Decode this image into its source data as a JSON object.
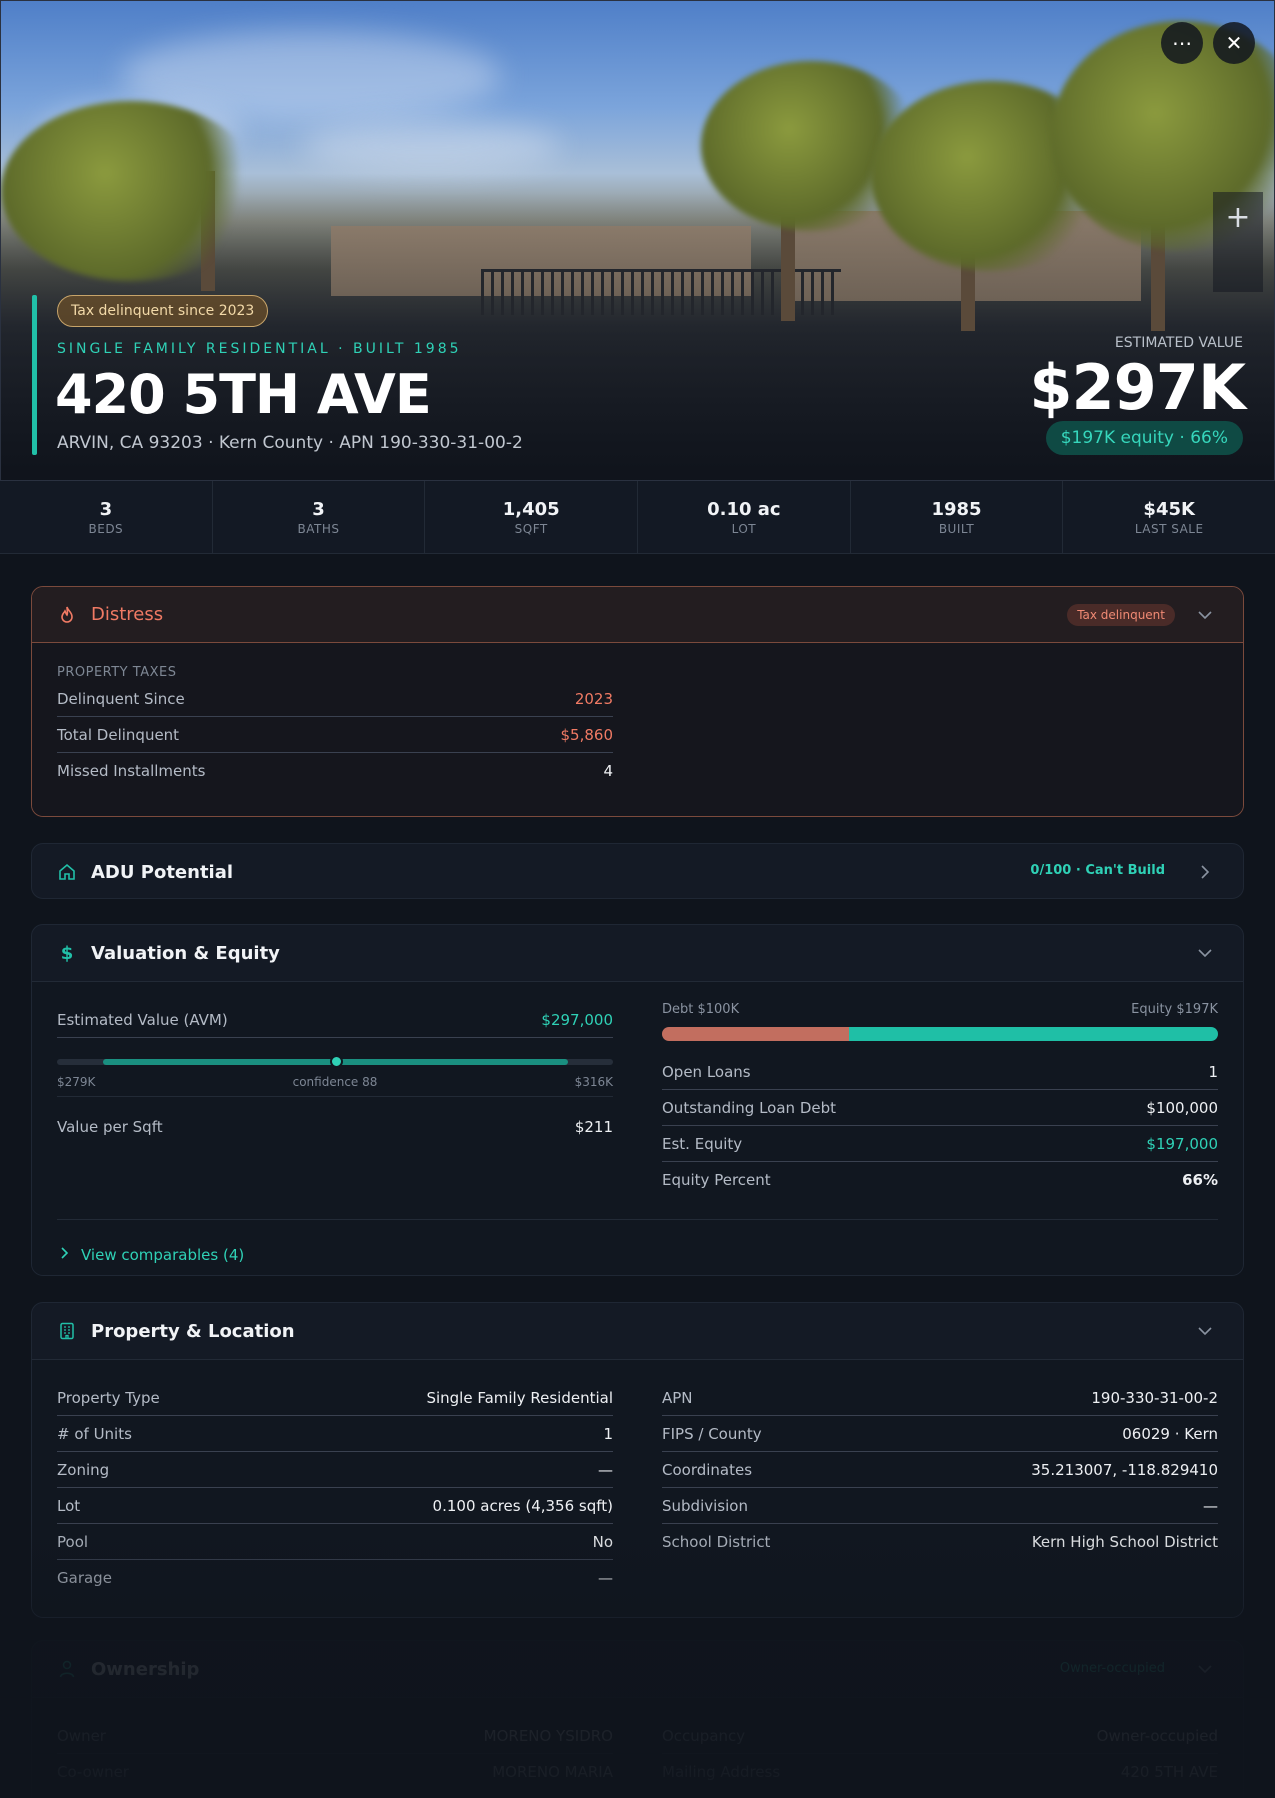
{
  "hero": {
    "tax_pill": "Tax delinquent since 2023",
    "subtype": "SINGLE FAMILY RESIDENTIAL · BUILT 1985",
    "address": "420 5TH AVE",
    "address_sub": "ARVIN, CA 93203 · Kern County · APN 190-330-31-00-2",
    "estimated_value_label": "ESTIMATED VALUE",
    "estimated_value": "$297K",
    "equity_pill": "$197K equity · 66%",
    "more_icon": "⋯",
    "close_icon": "✕",
    "zoom_in": "+",
    "zoom_out": ""
  },
  "stats": [
    {
      "value": "3",
      "label": "BEDS"
    },
    {
      "value": "3",
      "label": "BATHS"
    },
    {
      "value": "1,405",
      "label": "SQFT"
    },
    {
      "value": "0.10 ac",
      "label": "LOT"
    },
    {
      "value": "1985",
      "label": "BUILT"
    },
    {
      "value": "$45K",
      "label": "LAST SALE"
    }
  ],
  "distress": {
    "title": "Distress",
    "badge": "Tax delinquent",
    "section": "PROPERTY TAXES",
    "rows": [
      {
        "k": "Delinquent Since",
        "v": "2023"
      },
      {
        "k": "Total Delinquent",
        "v": "$5,860"
      },
      {
        "k": "Missed Installments",
        "v": "4"
      }
    ]
  },
  "adu": {
    "title": "ADU Potential",
    "score": "0/100 · Can't Build"
  },
  "valuation": {
    "title": "Valuation & Equity",
    "avm_label": "Estimated Value (AVM)",
    "avm_value": "$297,000",
    "avm_low": "$279K",
    "avm_confidence": "confidence 88",
    "avm_high": "$316K",
    "value_per_sqft_label": "Value per Sqft",
    "value_per_sqft": "$211",
    "debt_label": "Debt $100K",
    "equity_label": "Equity $197K",
    "debt_fraction": 0.337,
    "rows": [
      {
        "k": "Open Loans",
        "v": "1"
      },
      {
        "k": "Outstanding Loan Debt",
        "v": "$100,000"
      },
      {
        "k": "Est. Equity",
        "v": "$197,000"
      },
      {
        "k": "Equity Percent",
        "v": "66%"
      }
    ],
    "comparables": "View comparables (4)"
  },
  "property": {
    "title": "Property & Location",
    "left": [
      {
        "k": "Property Type",
        "v": "Single Family Residential"
      },
      {
        "k": "# of Units",
        "v": "1"
      },
      {
        "k": "Zoning",
        "v": "—"
      },
      {
        "k": "Lot",
        "v": "0.100 acres (4,356 sqft)"
      },
      {
        "k": "Pool",
        "v": "No"
      },
      {
        "k": "Garage",
        "v": "—"
      }
    ],
    "right": [
      {
        "k": "APN",
        "v": "190-330-31-00-2"
      },
      {
        "k": "FIPS / County",
        "v": "06029 · Kern"
      },
      {
        "k": "Coordinates",
        "v": "35.213007, -118.829410"
      },
      {
        "k": "Subdivision",
        "v": "—"
      },
      {
        "k": "School District",
        "v": "Kern High School District"
      }
    ]
  },
  "ownership": {
    "title": "Ownership",
    "badge": "Owner-occupied",
    "left": [
      {
        "k": "Owner",
        "v": "MORENO YSIDRO"
      },
      {
        "k": "Co-owner",
        "v": "MORENO MARIA"
      }
    ],
    "right": [
      {
        "k": "Occupancy",
        "v": "Owner-occupied"
      },
      {
        "k": "Mailing Address",
        "v": "420 5TH AVE"
      }
    ]
  },
  "colors": {
    "accent": "#21c0a8",
    "distress": "#f07a64",
    "background": "#0f141c"
  }
}
